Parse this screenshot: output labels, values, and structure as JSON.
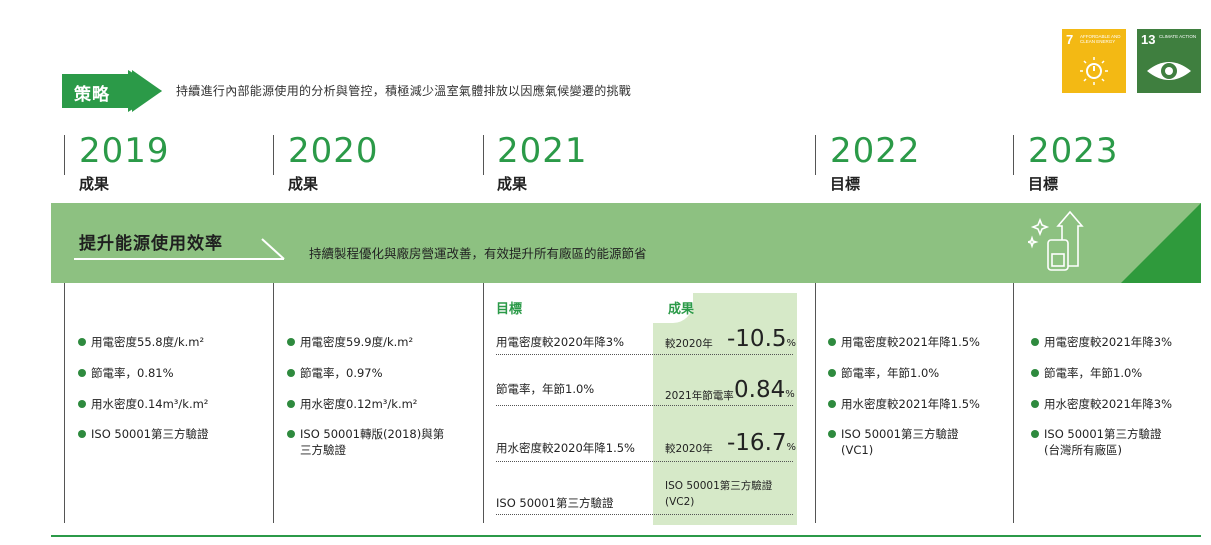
{
  "strategy": {
    "badge_label": "策略",
    "text": "持續進行內部能源使用的分析與管控，積極減少溫室氣體排放以因應氣候變遷的挑戰"
  },
  "sdgs": [
    {
      "number": "7",
      "caption": "AFFORDABLE AND CLEAN ENERGY",
      "color": "#f3b914",
      "icon": "sun-power-icon"
    },
    {
      "number": "13",
      "caption": "CLIMATE ACTION",
      "color": "#3f7f3f",
      "icon": "eye-globe-icon"
    }
  ],
  "columns": [
    {
      "year": "2019",
      "label": "成果"
    },
    {
      "year": "2020",
      "label": "成果"
    },
    {
      "year": "2021",
      "label": "成果"
    },
    {
      "year": "2022",
      "label": "目標"
    },
    {
      "year": "2023",
      "label": "目標"
    }
  ],
  "band": {
    "title": "提升能源使用效率",
    "description": "持續製程優化與廠房營運改善，有效提升所有廠區的能源節省",
    "icon": "energy-efficiency-icon"
  },
  "col2019": [
    "用電密度55.8度/k.m²",
    "節電率，0.81%",
    "用水密度0.14m³/k.m²",
    "ISO 50001第三方驗證"
  ],
  "col2020": [
    "用電密度59.9度/k.m²",
    "節電率，0.97%",
    "用水密度0.12m³/k.m²",
    "ISO 50001轉版(2018)與第",
    "三方驗證"
  ],
  "col2021": {
    "target_label": "目標",
    "result_label": "成果",
    "targets": [
      "用電密度較2020年降3%",
      "節電率，年節1.0%",
      "用水密度較2020年降1.5%",
      "ISO 50001第三方驗證"
    ],
    "results": [
      {
        "prefix": "較2020年",
        "value": "-10.5",
        "unit": "%"
      },
      {
        "prefix": "2021年節電率",
        "value": "0.84",
        "unit": "%"
      },
      {
        "prefix": "較2020年",
        "value": "-16.7",
        "unit": "%"
      },
      {
        "line1": "ISO 50001第三方驗證",
        "line2": "(VC2)"
      }
    ]
  },
  "col2022": [
    "用電密度較2021年降1.5%",
    "節電率，年節1.0%",
    "用水密度較2021年降1.5%",
    "ISO 50001第三方驗證",
    "(VC1)"
  ],
  "col2023": [
    "用電密度較2021年降3%",
    "節電率，年節1.0%",
    "用水密度較2021年降3%",
    "ISO 50001第三方驗證",
    "(台灣所有廠區)"
  ],
  "colors": {
    "brand_green": "#2b9a48",
    "band": "#8dc181",
    "band_dark": "#2f9a3c",
    "result_bg": "#d6e9c8"
  }
}
